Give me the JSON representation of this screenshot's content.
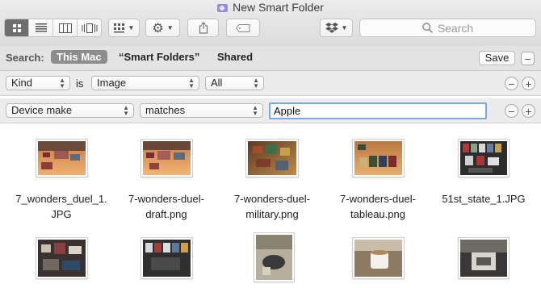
{
  "window": {
    "title": "New Smart Folder"
  },
  "toolbar": {
    "search_placeholder": "Search",
    "icons": [
      "icon-view-icon",
      "list-view-icon",
      "column-view-icon",
      "cover-flow-icon",
      "group-icon",
      "gear-icon",
      "share-icon",
      "tag-icon",
      "dropbox-icon",
      "search-icon"
    ]
  },
  "scope": {
    "label": "Search:",
    "this_mac": "This Mac",
    "smart_folders": "“Smart Folders”",
    "shared": "Shared",
    "save": "Save",
    "minus": "−"
  },
  "criteria": [
    {
      "attribute": "Kind",
      "connector": "is",
      "value": "Image",
      "qualifier": "All"
    },
    {
      "attribute": "Device make",
      "operator": "matches",
      "value": "Apple"
    }
  ],
  "buttons": {
    "minus": "−",
    "plus": "+"
  },
  "files": [
    {
      "name_line1": "7_wonders_duel_1.",
      "name_line2": "JPG"
    },
    {
      "name_line1": "7-wonders-duel-",
      "name_line2": "draft.png"
    },
    {
      "name_line1": "7-wonders-duel-",
      "name_line2": "military.png"
    },
    {
      "name_line1": "7-wonders-duel-",
      "name_line2": "tableau.png"
    },
    {
      "name_line1": "51st_state_1.JPG",
      "name_line2": ""
    }
  ],
  "colors": {
    "accent_focus": "#7aa7e6",
    "scope_active": "#8d8d8d",
    "folder": "#9b8be0"
  }
}
